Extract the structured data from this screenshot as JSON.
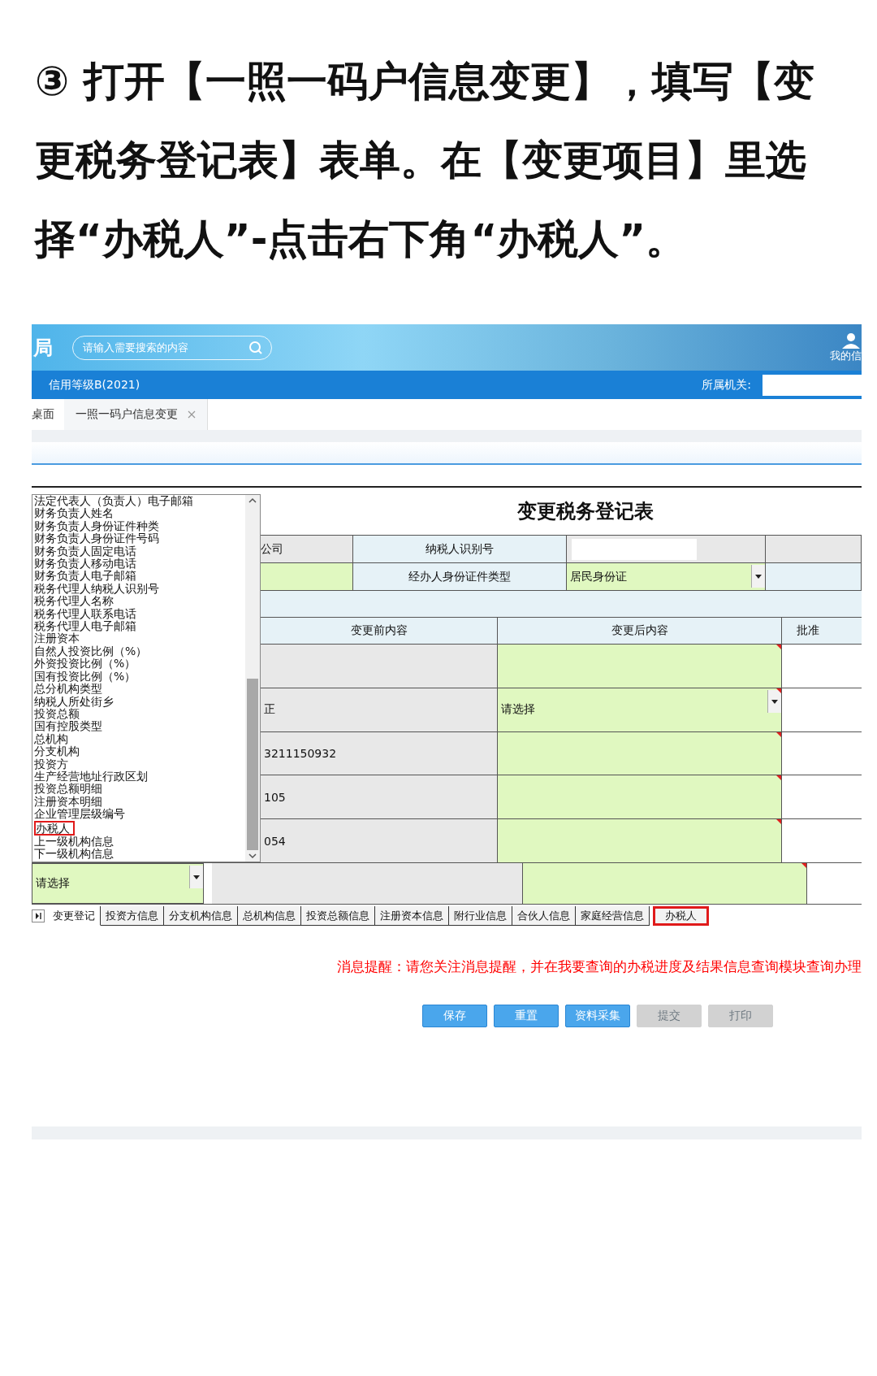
{
  "heading": "③ 打开【一照一码户信息变更】，填写【变更税务登记表】表单。在【变更项目】里选择“办税人”-点击右下角“办税人”。",
  "banner": {
    "logo_text": "局",
    "search_placeholder": "请输入需要搜索的内容",
    "user_label": "我的信"
  },
  "info_bar": {
    "credit": "信用等级B(2021)",
    "authority_label": "所属机关:"
  },
  "page_tabs": [
    {
      "label": "桌面",
      "selected": false,
      "closable": false
    },
    {
      "label": "一照一码户信息变更",
      "selected": true,
      "closable": true
    }
  ],
  "item_list": [
    {
      "label": "法定代表人（负责人）电子邮箱",
      "highlighted": false
    },
    {
      "label": "财务负责人姓名",
      "highlighted": false
    },
    {
      "label": "财务负责人身份证件种类",
      "highlighted": false
    },
    {
      "label": "财务负责人身份证件号码",
      "highlighted": false
    },
    {
      "label": "财务负责人固定电话",
      "highlighted": false
    },
    {
      "label": "财务负责人移动电话",
      "highlighted": false
    },
    {
      "label": "财务负责人电子邮箱",
      "highlighted": false
    },
    {
      "label": "税务代理人纳税人识别号",
      "highlighted": false
    },
    {
      "label": "税务代理人名称",
      "highlighted": false
    },
    {
      "label": "税务代理人联系电话",
      "highlighted": false
    },
    {
      "label": "税务代理人电子邮箱",
      "highlighted": false
    },
    {
      "label": "注册资本",
      "highlighted": false
    },
    {
      "label": "自然人投资比例（%）",
      "highlighted": false
    },
    {
      "label": "外资投资比例（%）",
      "highlighted": false
    },
    {
      "label": "国有投资比例（%）",
      "highlighted": false
    },
    {
      "label": "总分机构类型",
      "highlighted": false
    },
    {
      "label": "纳税人所处街乡",
      "highlighted": false
    },
    {
      "label": "投资总额",
      "highlighted": false
    },
    {
      "label": "国有控股类型",
      "highlighted": false
    },
    {
      "label": "总机构",
      "highlighted": false
    },
    {
      "label": "分支机构",
      "highlighted": false
    },
    {
      "label": "投资方",
      "highlighted": false
    },
    {
      "label": "生产经营地址行政区划",
      "highlighted": false
    },
    {
      "label": "投资总额明细",
      "highlighted": false
    },
    {
      "label": "注册资本明细",
      "highlighted": false
    },
    {
      "label": "企业管理层级编号",
      "highlighted": false
    },
    {
      "label": "办税人",
      "highlighted": true
    },
    {
      "label": "上一级机构信息",
      "highlighted": false
    },
    {
      "label": "下一级机构信息",
      "highlighted": false
    }
  ],
  "form": {
    "title": "变更税务登记表",
    "row_1": {
      "cell_1": "公司",
      "label": "纳税人识别号"
    },
    "row_2": {
      "label": "经办人身份证件类型",
      "value": "居民身份证"
    },
    "columns": [
      "变更前内容",
      "变更后内容",
      "批准"
    ],
    "rows": [
      {
        "kind": "text"
      },
      {
        "before": "正",
        "kind": "select",
        "value": "请选择"
      },
      {
        "before": "3211150932",
        "kind": "text"
      },
      {
        "before": "105",
        "kind": "text"
      },
      {
        "before": "054",
        "kind": "text"
      }
    ],
    "bottom_select": "请选择"
  },
  "sheet_tabs": [
    {
      "label": "变更登记",
      "selected": true,
      "highlighted": false
    },
    {
      "label": "投资方信息",
      "selected": false,
      "highlighted": false
    },
    {
      "label": "分支机构信息",
      "selected": false,
      "highlighted": false
    },
    {
      "label": "总机构信息",
      "selected": false,
      "highlighted": false
    },
    {
      "label": "投资总额信息",
      "selected": false,
      "highlighted": false
    },
    {
      "label": "注册资本信息",
      "selected": false,
      "highlighted": false
    },
    {
      "label": "附行业信息",
      "selected": false,
      "highlighted": false
    },
    {
      "label": "合伙人信息",
      "selected": false,
      "highlighted": false
    },
    {
      "label": "家庭经营信息",
      "selected": false,
      "highlighted": false
    },
    {
      "label": "办税人",
      "selected": false,
      "highlighted": true
    }
  ],
  "message": "消息提醒：请您关注消息提醒，并在我要查询的办税进度及结果信息查询模块查询办理",
  "buttons": [
    {
      "label": "保存",
      "disabled": false
    },
    {
      "label": "重置",
      "disabled": false
    },
    {
      "label": "资料采集",
      "disabled": false
    },
    {
      "label": "提交",
      "disabled": true
    },
    {
      "label": "打印",
      "disabled": true
    }
  ]
}
